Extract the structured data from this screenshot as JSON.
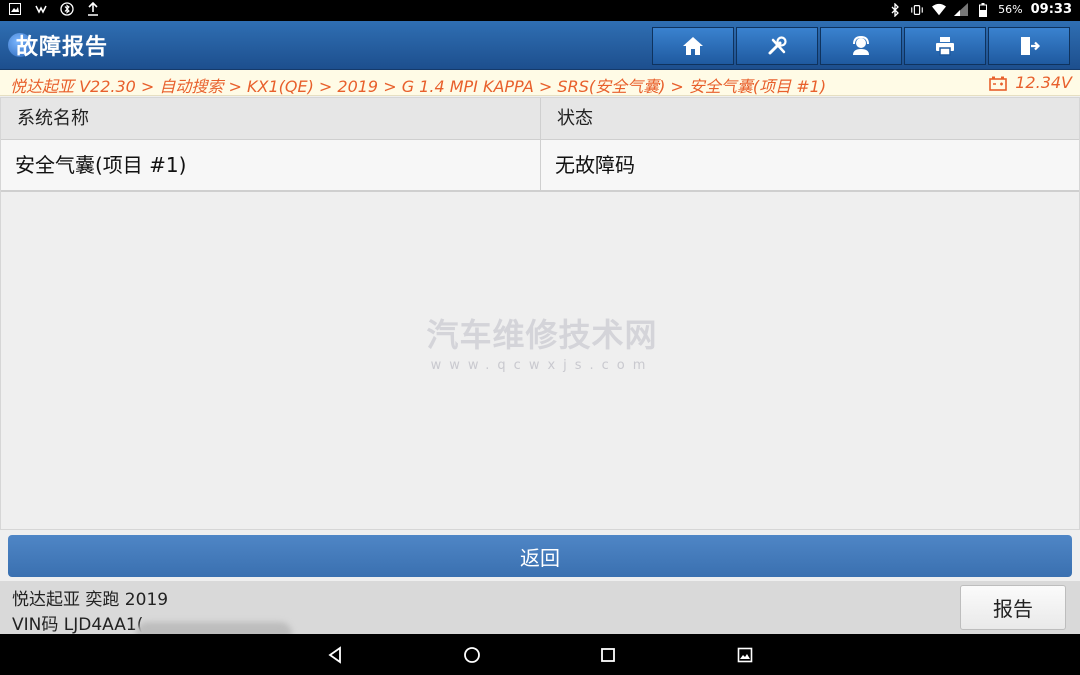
{
  "status_bar": {
    "battery": "56%",
    "time": "09:33"
  },
  "header": {
    "title": "故障报告",
    "toolbar": [
      {
        "name": "home-button",
        "icon": "home-icon"
      },
      {
        "name": "tools-button",
        "icon": "wrench-screwdriver-icon"
      },
      {
        "name": "support-button",
        "icon": "headset-person-icon"
      },
      {
        "name": "print-button",
        "icon": "printer-icon"
      },
      {
        "name": "exit-button",
        "icon": "exit-door-icon"
      }
    ]
  },
  "breadcrumb": {
    "path": "悦达起亚 V22.30 > 自动搜索 > KX1(QE) > 2019 > G 1.4 MPI KAPPA > SRS(安全气囊) > 安全气囊(项目 #1)",
    "voltage": "12.34V"
  },
  "table": {
    "headers": [
      "系统名称",
      "状态"
    ],
    "rows": [
      {
        "system": "安全气囊(项目 #1)",
        "status": "无故障码"
      }
    ]
  },
  "watermark": {
    "text": "汽车维修技术网",
    "url": "www.qcwxjs.com"
  },
  "actions": {
    "back_label": "返回",
    "report_label": "报告"
  },
  "footer": {
    "vehicle": "悦达起亚 奕跑 2019",
    "vin": "VIN码 LJD4AA1("
  },
  "colors": {
    "header_blue": "#1d4f8e",
    "breadcrumb_orange": "#e8602c",
    "back_button_blue": "#3a70b0"
  }
}
